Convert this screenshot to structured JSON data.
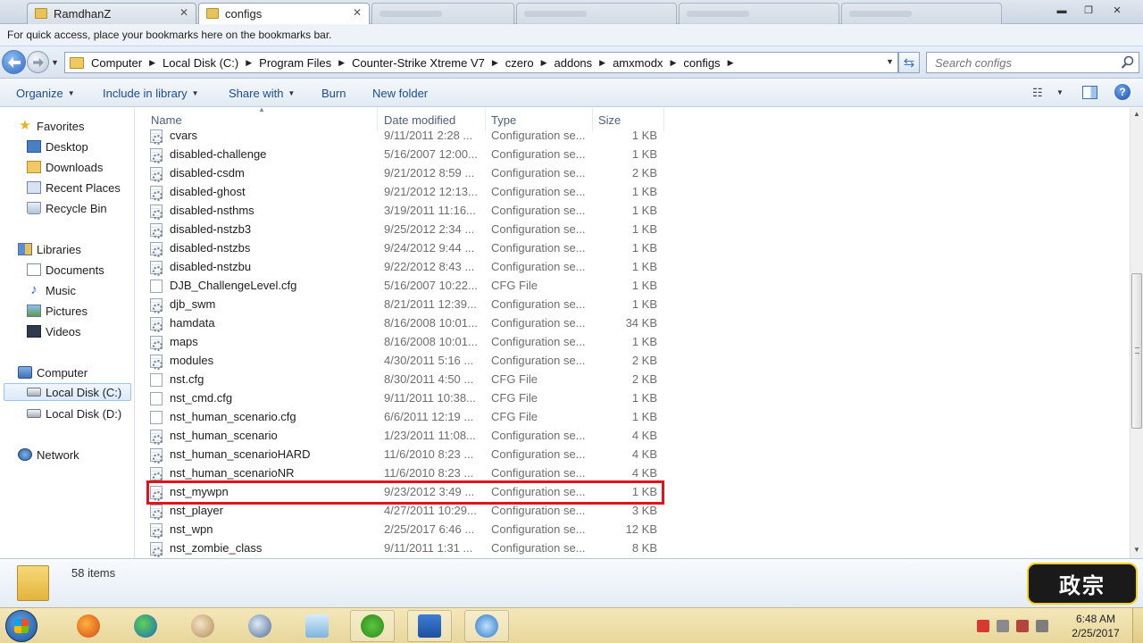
{
  "browser": {
    "tabs": [
      {
        "label": "RamdhanZ",
        "active": false
      },
      {
        "label": "configs",
        "active": true
      }
    ],
    "bookmarks_hint": "For quick access, place your bookmarks here on the bookmarks bar."
  },
  "address": {
    "crumbs": [
      "Computer",
      "Local Disk (C:)",
      "Program Files",
      "Counter-Strike Xtreme V7",
      "czero",
      "addons",
      "amxmodx",
      "configs"
    ],
    "search_placeholder": "Search configs"
  },
  "toolbar": {
    "organize": "Organize",
    "include_in_library": "Include in library",
    "share_with": "Share with",
    "burn": "Burn",
    "new_folder": "New folder",
    "help": "?"
  },
  "nav": {
    "favorites": "Favorites",
    "desktop": "Desktop",
    "downloads": "Downloads",
    "recent_places": "Recent Places",
    "recycle_bin": "Recycle Bin",
    "libraries": "Libraries",
    "documents": "Documents",
    "music": "Music",
    "pictures": "Pictures",
    "videos": "Videos",
    "computer": "Computer",
    "local_c": "Local Disk (C:)",
    "local_d": "Local Disk (D:)",
    "network": "Network"
  },
  "columns": {
    "name": "Name",
    "date": "Date modified",
    "type": "Type",
    "size": "Size"
  },
  "files": [
    {
      "name": "cvars",
      "date": "9/11/2011 2:28 ...",
      "type": "Configuration se...",
      "size": "1 KB",
      "cfg": true
    },
    {
      "name": "disabled-challenge",
      "date": "5/16/2007 12:00...",
      "type": "Configuration se...",
      "size": "1 KB",
      "cfg": true
    },
    {
      "name": "disabled-csdm",
      "date": "9/21/2012 8:59 ...",
      "type": "Configuration se...",
      "size": "2 KB",
      "cfg": true
    },
    {
      "name": "disabled-ghost",
      "date": "9/21/2012 12:13...",
      "type": "Configuration se...",
      "size": "1 KB",
      "cfg": true
    },
    {
      "name": "disabled-nsthms",
      "date": "3/19/2011 11:16...",
      "type": "Configuration se...",
      "size": "1 KB",
      "cfg": true
    },
    {
      "name": "disabled-nstzb3",
      "date": "9/25/2012 2:34 ...",
      "type": "Configuration se...",
      "size": "1 KB",
      "cfg": true
    },
    {
      "name": "disabled-nstzbs",
      "date": "9/24/2012 9:44 ...",
      "type": "Configuration se...",
      "size": "1 KB",
      "cfg": true
    },
    {
      "name": "disabled-nstzbu",
      "date": "9/22/2012 8:43 ...",
      "type": "Configuration se...",
      "size": "1 KB",
      "cfg": true
    },
    {
      "name": "DJB_ChallengeLevel.cfg",
      "date": "5/16/2007 10:22...",
      "type": "CFG File",
      "size": "1 KB",
      "cfg": false
    },
    {
      "name": "djb_swm",
      "date": "8/21/2011 12:39...",
      "type": "Configuration se...",
      "size": "1 KB",
      "cfg": true
    },
    {
      "name": "hamdata",
      "date": "8/16/2008 10:01...",
      "type": "Configuration se...",
      "size": "34 KB",
      "cfg": true
    },
    {
      "name": "maps",
      "date": "8/16/2008 10:01...",
      "type": "Configuration se...",
      "size": "1 KB",
      "cfg": true
    },
    {
      "name": "modules",
      "date": "4/30/2011 5:16 ...",
      "type": "Configuration se...",
      "size": "2 KB",
      "cfg": true
    },
    {
      "name": "nst.cfg",
      "date": "8/30/2011 4:50 ...",
      "type": "CFG File",
      "size": "2 KB",
      "cfg": false
    },
    {
      "name": "nst_cmd.cfg",
      "date": "9/11/2011 10:38...",
      "type": "CFG File",
      "size": "1 KB",
      "cfg": false
    },
    {
      "name": "nst_human_scenario.cfg",
      "date": "6/6/2011 12:19 ...",
      "type": "CFG File",
      "size": "1 KB",
      "cfg": false
    },
    {
      "name": "nst_human_scenario",
      "date": "1/23/2011 11:08...",
      "type": "Configuration se...",
      "size": "4 KB",
      "cfg": true
    },
    {
      "name": "nst_human_scenarioHARD",
      "date": "11/6/2010 8:23 ...",
      "type": "Configuration se...",
      "size": "4 KB",
      "cfg": true
    },
    {
      "name": "nst_human_scenarioNR",
      "date": "11/6/2010 8:23 ...",
      "type": "Configuration se...",
      "size": "4 KB",
      "cfg": true
    },
    {
      "name": "nst_mywpn",
      "date": "9/23/2012 3:49 ...",
      "type": "Configuration se...",
      "size": "1 KB",
      "cfg": true
    },
    {
      "name": "nst_player",
      "date": "4/27/2011 10:29...",
      "type": "Configuration se...",
      "size": "3 KB",
      "cfg": true
    },
    {
      "name": "nst_wpn",
      "date": "2/25/2017 6:46 ...",
      "type": "Configuration se...",
      "size": "12 KB",
      "cfg": true
    },
    {
      "name": "nst_zombie_class",
      "date": "9/11/2011 1:31 ...",
      "type": "Configuration se...",
      "size": "8 KB",
      "cfg": true
    }
  ],
  "details": {
    "item_count": "58 items"
  },
  "taskbar": {
    "time": "6:48 AM",
    "date": "2/25/2017"
  }
}
